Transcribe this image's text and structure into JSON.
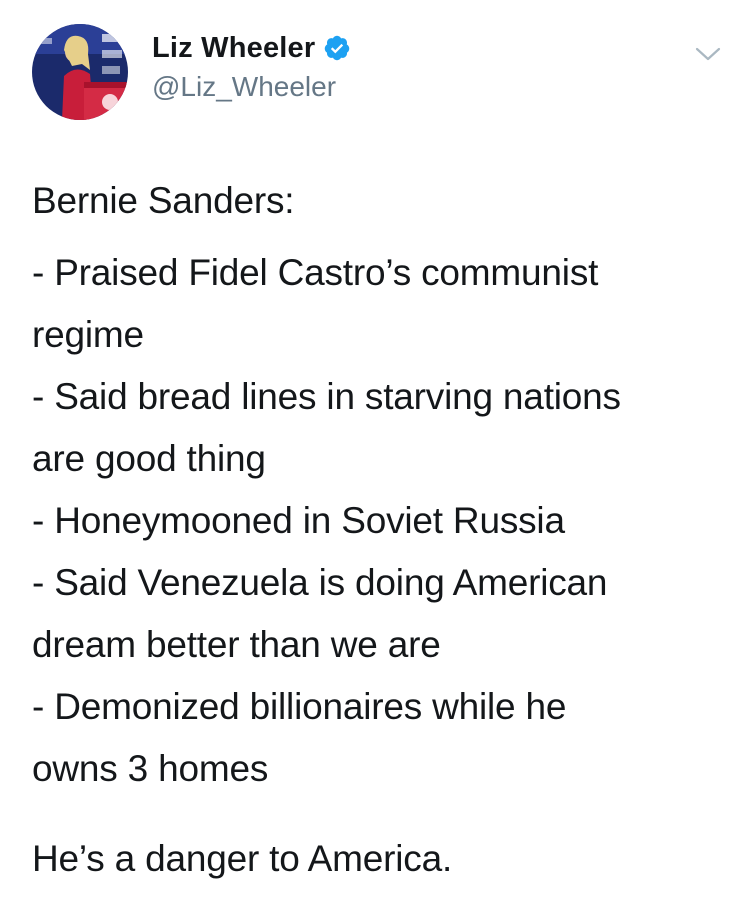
{
  "author": {
    "display_name": "Liz Wheeler",
    "handle": "@Liz_Wheeler",
    "verified": true,
    "avatar_icon": "profile-photo",
    "verified_icon": "verified-badge-icon",
    "verified_color": "#1da1f2"
  },
  "menu": {
    "icon": "chevron-down-icon"
  },
  "tweet": {
    "lines": [
      "Bernie Sanders:",
      "- Praised Fidel Castro’s communist",
      "regime",
      "- Said bread lines in starving nations",
      "are good thing",
      "- Honeymooned in Soviet Russia",
      "- Said Venezuela is doing American",
      "dream better than we are",
      "- Demonized billionaires while he",
      "owns 3 homes"
    ],
    "closing": "He’s a danger to America."
  },
  "colors": {
    "text": "#14171a",
    "secondary": "#657786",
    "accent": "#1da1f2"
  }
}
